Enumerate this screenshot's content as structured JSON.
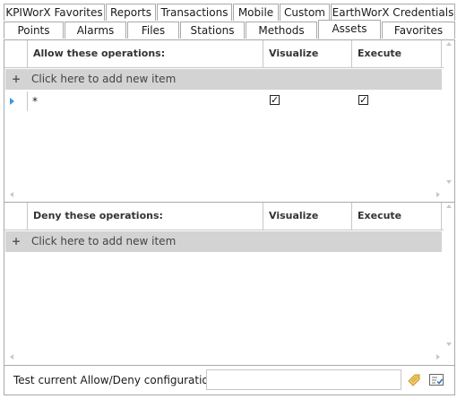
{
  "tabs_row1": [
    "KPIWorX Favorites",
    "Reports",
    "Transactions",
    "Mobile",
    "Custom",
    "EarthWorX Credentials"
  ],
  "tabs_row2": [
    "Points",
    "Alarms",
    "Files",
    "Stations",
    "Methods",
    "Assets",
    "Favorites"
  ],
  "active_tab": "Assets",
  "allow_grid": {
    "columns": [
      "Allow these operations:",
      "Visualize",
      "Execute"
    ],
    "add_label": "Click here to add new item",
    "rows": [
      {
        "operation": "*",
        "visualize": true,
        "execute": true
      }
    ]
  },
  "deny_grid": {
    "columns": [
      "Deny these operations:",
      "Visualize",
      "Execute"
    ],
    "add_label": "Click here to add new item",
    "rows": []
  },
  "footer": {
    "test_label": "Test current Allow/Deny configuration:",
    "test_value": "",
    "icons": [
      "tag-icon",
      "test-checklist-icon"
    ]
  },
  "colors": {
    "add_row_bg": "#d3d3d3",
    "row_marker": "#3a96dd",
    "border": "#a9a9a9",
    "tag_icon": "#e8b84a"
  }
}
